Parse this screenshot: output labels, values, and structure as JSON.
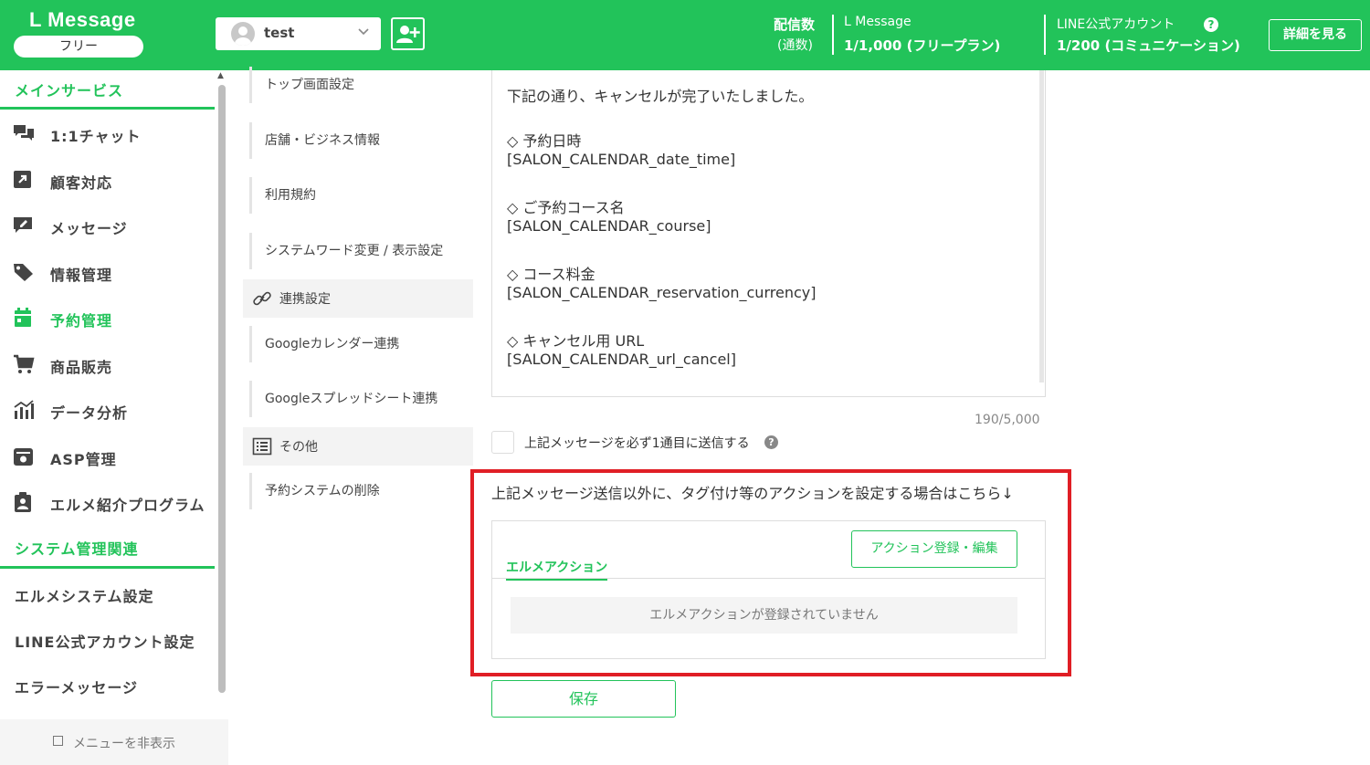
{
  "header": {
    "logo": "L Message",
    "plan": "フリー",
    "account_name": "test",
    "stat_label": "配信数",
    "stat_sub": "(通数)",
    "lmessage_title": "L Message",
    "lmessage_count": "1/1,000 (フリープラン)",
    "line_title": "LINE公式アカウント",
    "line_count": "1/200 (コミュニケーション)",
    "detail_button": "詳細を見る",
    "brand_color": "#22c35a"
  },
  "sidebar": {
    "section_main": "メインサービス",
    "items": [
      {
        "label": "1:1チャット",
        "icon": "chat-icon"
      },
      {
        "label": "顧客対応",
        "icon": "external-link-icon"
      },
      {
        "label": "メッセージ",
        "icon": "message-edit-icon"
      },
      {
        "label": "情報管理",
        "icon": "tag-icon"
      },
      {
        "label": "予約管理",
        "icon": "calendar-icon"
      },
      {
        "label": "商品販売",
        "icon": "cart-icon"
      },
      {
        "label": "データ分析",
        "icon": "bar-chart-icon"
      },
      {
        "label": "ASP管理",
        "icon": "asp-icon"
      },
      {
        "label": "エルメ紹介プログラム",
        "icon": "clipboard-user-icon"
      }
    ],
    "section_system": "システム管理関連",
    "system_items": [
      "エルメシステム設定",
      "LINE公式アカウント設定",
      "エラーメッセージ"
    ],
    "hide_menu": "メニューを非表示"
  },
  "submenu": {
    "items": [
      "トップ画面設定",
      "店舗・ビジネス情報",
      "利用規約",
      "システムワード変更 / 表示設定"
    ],
    "head_link": "連携設定",
    "link_items": [
      "Googleカレンダー連携",
      "Googleスプレッドシート連携"
    ],
    "head_other": "その他",
    "other_items": [
      "予約システムの削除"
    ]
  },
  "main": {
    "message_lines": [
      "下記の通り、キャンセルが完了いたしました。",
      "◇ 予約日時",
      "[SALON_CALENDAR_date_time]",
      "◇ ご予約コース名",
      "[SALON_CALENDAR_course]",
      "◇ コース料金",
      "[SALON_CALENDAR_reservation_currency]",
      "◇ キャンセル用 URL",
      "[SALON_CALENDAR_url_cancel]"
    ],
    "char_count": "190/5,000",
    "checkbox_label": "上記メッセージを必ず1通目に送信する",
    "action_note": "上記メッセージ送信以外に、タグ付け等のアクションを設定する場合はこちら↓",
    "action_tab": "エルメアクション",
    "action_edit_button": "アクション登録・編集",
    "action_empty": "エルメアクションが登録されていません",
    "save_button": "保存"
  }
}
